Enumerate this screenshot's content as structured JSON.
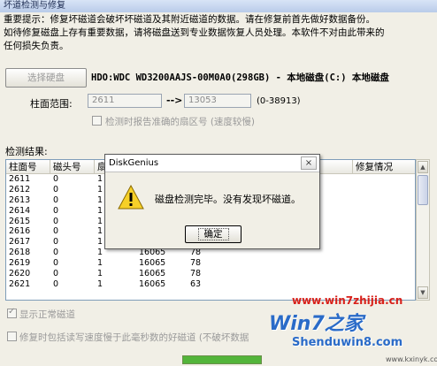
{
  "window": {
    "title": "坏道检测与修复"
  },
  "notice": {
    "lines": [
      "重要提示：修复坏磁道会破坏坏磁道及其附近磁道的数据。请在修复前首先做好数据备份。",
      "如待修复磁盘上存有重要数据，请将磁盘送到专业数据恢复人员处理。本软件不对由此带来的",
      "任何损失负责。"
    ]
  },
  "toolbar": {
    "select_disk_label": "选择硬盘",
    "disk_info": "HDO:WDC WD3200AAJS-00M0A0(298GB) - 本地磁盘(C:) 本地磁盘"
  },
  "cylinder": {
    "label": "柱面范围:",
    "start": "2611",
    "arrow": "-->",
    "end": "13053",
    "range_text": "(0-38913)"
  },
  "options": {
    "report_sector": "检测时报告准确的扇区号 (速度较慢)",
    "show_normal": "显示正常磁道",
    "repair_slow": "修复时包括读写速度慢于此毫秒数的好磁道 (不破坏数据"
  },
  "results": {
    "label": "检测结果:",
    "columns": [
      "柱面号",
      "磁头号",
      "扇",
      "",
      "",
      "",
      "",
      "修复情况"
    ],
    "rows": [
      [
        "2611",
        "0",
        "1",
        "",
        ""
      ],
      [
        "2612",
        "0",
        "1",
        "",
        ""
      ],
      [
        "2613",
        "0",
        "1",
        "",
        ""
      ],
      [
        "2614",
        "0",
        "1",
        "",
        ""
      ],
      [
        "2615",
        "0",
        "1",
        "",
        ""
      ],
      [
        "2616",
        "0",
        "1",
        "",
        ""
      ],
      [
        "2617",
        "0",
        "1",
        "",
        ""
      ],
      [
        "2618",
        "0",
        "1",
        "16065",
        "78"
      ],
      [
        "2619",
        "0",
        "1",
        "16065",
        "78"
      ],
      [
        "2620",
        "0",
        "1",
        "16065",
        "78"
      ],
      [
        "2621",
        "0",
        "1",
        "16065",
        "63"
      ]
    ]
  },
  "dialog": {
    "title": "DiskGenius",
    "close": "×",
    "message": "磁盘检测完毕。没有发现坏磁道。",
    "ok": "确定"
  },
  "watermark": {
    "site1": "www.win7zhijia.cn",
    "logo": "Win7之家",
    "site2": "Shenduwin8.com",
    "site3": "www.kxinyk.com"
  },
  "progress": {
    "value": 1.0
  },
  "colors": {
    "accent": "#2a6bc8",
    "watermark_red": "#d8201a"
  }
}
